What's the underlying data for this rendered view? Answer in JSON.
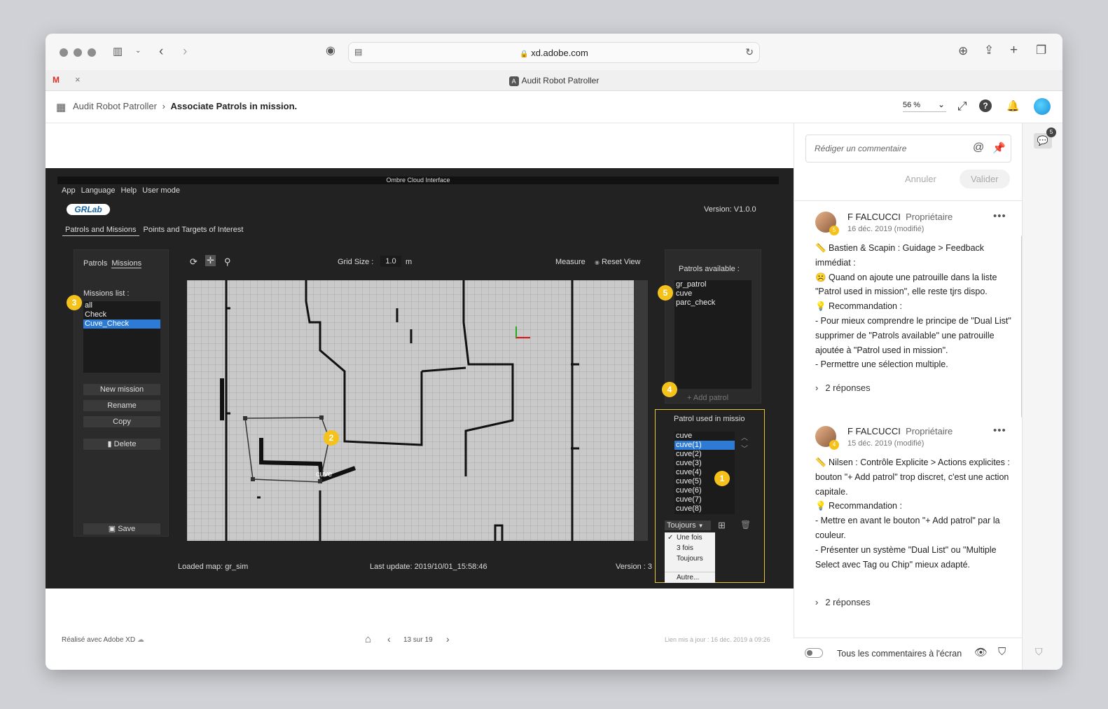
{
  "browser": {
    "url": "xd.adobe.com",
    "tab_title": "Audit Robot Patroller",
    "tab_favicon_letter": "A"
  },
  "xd_header": {
    "breadcrumb_root": "Audit Robot Patroller",
    "breadcrumb_current": "Associate Patrols in mission.",
    "zoom": "56 %"
  },
  "app": {
    "window_title": "Ombre Cloud Interface",
    "menu": [
      "App",
      "Language",
      "Help",
      "User mode"
    ],
    "logo": "GRLab",
    "version": "Version:  V1.0.0",
    "tabs": [
      "Patrols and Missions",
      "Points and Targets of Interest"
    ],
    "subtabs": [
      "Patrols",
      "Missions"
    ],
    "missions_label": "Missions list :",
    "missions": [
      "all",
      "Check",
      "Cuve_Check"
    ],
    "buttons": {
      "new_mission": "New mission",
      "rename": "Rename",
      "copy": "Copy",
      "delete": "Delete",
      "save": "Save"
    },
    "grid_label": "Grid Size :",
    "grid_value": "1.0",
    "grid_unit": "m",
    "measure": "Measure",
    "reset_view": "Reset View",
    "map_label": "cuve",
    "patrols_available_label": "Patrols  available :",
    "patrols_available": [
      "gr_patrol",
      "cuve",
      "parc_check"
    ],
    "add_patrol": "Add patrol",
    "patrol_used_label": "Patrol used in missio",
    "patrol_used": [
      "cuve",
      "cuve(1)",
      "cuve(2)",
      "cuve(3)",
      "cuve(4)",
      "cuve(5)",
      "cuve(6)",
      "cuve(7)",
      "cuve(8)"
    ],
    "repeat_select": "Toujours",
    "repeat_options": [
      "Une fois",
      "3 fois",
      "Toujours",
      "Autre..."
    ],
    "status_map": "Loaded map: gr_sim",
    "status_update": "Last update:  2019/10/01_15:58:46",
    "status_version": "Version :  3",
    "annotations": [
      "1",
      "2",
      "3",
      "4",
      "5"
    ]
  },
  "footer": {
    "made_with": "Réalisé avec Adobe XD",
    "pages": "13 sur 19",
    "updated": "Lien mis à jour : 16 déc. 2019 à 09:26"
  },
  "comments_panel": {
    "placeholder": "Rédiger un commentaire",
    "cancel": "Annuler",
    "submit": "Valider",
    "badge_count": "5",
    "comments": [
      {
        "author": "F FALCUCCI",
        "role": "Propriétaire",
        "date": "16 déc. 2019 (modifié)",
        "pin": "5",
        "lines": [
          "📏 Bastien & Scapin : Guidage > Feedback immédiat :",
          "☹️ Quand on ajoute une patrouille dans la liste \"Patrol used in mission\", elle reste tjrs dispo.",
          "💡 Recommandation :",
          "- Pour mieux comprendre le principe de \"Dual List\" supprimer de \"Patrols available\" une patrouille ajoutée à \"Patrol used in mission\".",
          "- Permettre une sélection multiple."
        ],
        "replies": "2 réponses"
      },
      {
        "author": "F FALCUCCI",
        "role": "Propriétaire",
        "date": "15 déc. 2019 (modifié)",
        "pin": "4",
        "lines": [
          "📏 Nilsen : Contrôle Explicite > Actions explicites :",
          "bouton \"+ Add patrol\" trop discret, c'est une action capitale.",
          "💡 Recommandation :",
          "- Mettre en avant le bouton \"+ Add patrol\" par la couleur.",
          "- Présenter un système \"Dual List\" ou \"Multiple Select avec Tag ou Chip\" mieux adapté."
        ],
        "replies": "2 réponses"
      }
    ],
    "show_all": "Tous les commentaires à l'écran"
  }
}
